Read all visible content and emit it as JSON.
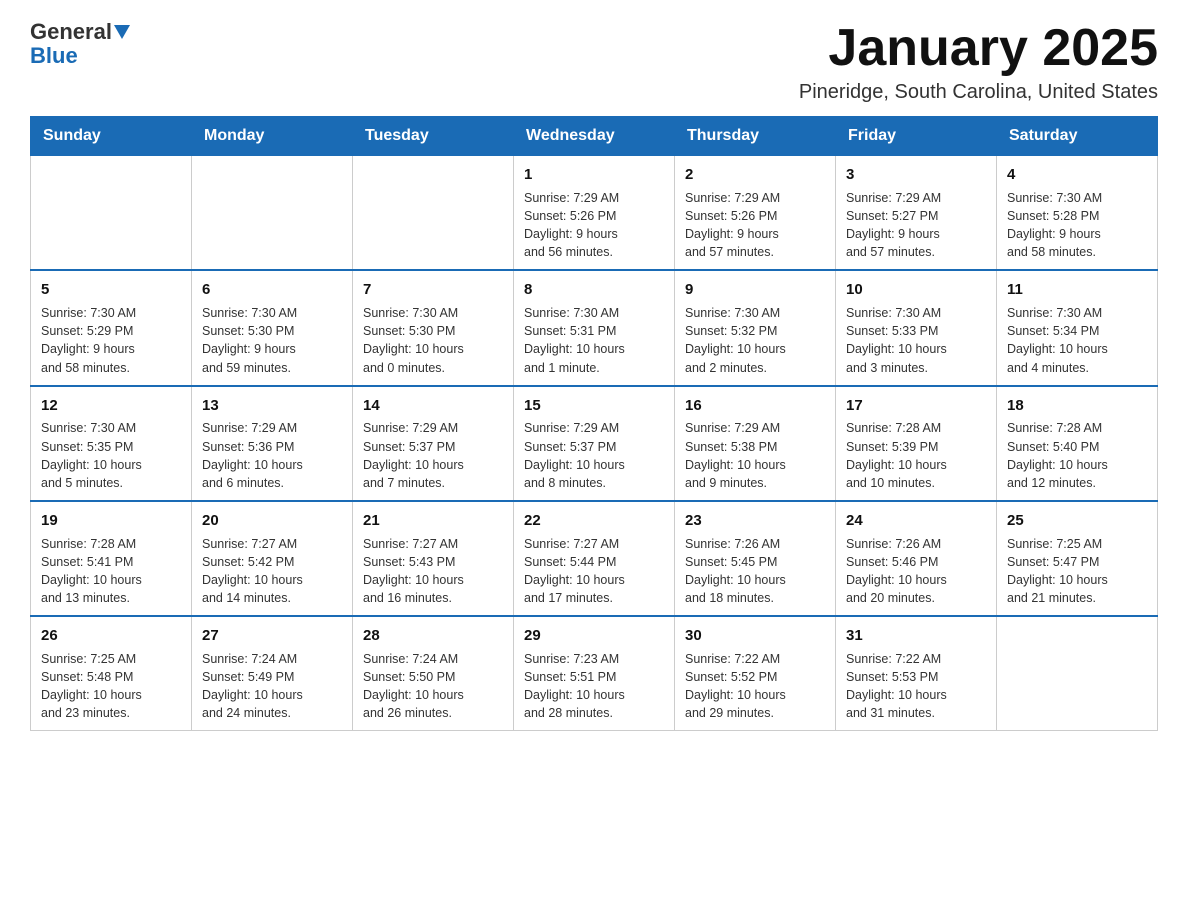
{
  "logo": {
    "text_general": "General",
    "text_blue": "Blue"
  },
  "title": "January 2025",
  "subtitle": "Pineridge, South Carolina, United States",
  "weekdays": [
    "Sunday",
    "Monday",
    "Tuesday",
    "Wednesday",
    "Thursday",
    "Friday",
    "Saturday"
  ],
  "weeks": [
    [
      {
        "day": "",
        "info": ""
      },
      {
        "day": "",
        "info": ""
      },
      {
        "day": "",
        "info": ""
      },
      {
        "day": "1",
        "info": "Sunrise: 7:29 AM\nSunset: 5:26 PM\nDaylight: 9 hours\nand 56 minutes."
      },
      {
        "day": "2",
        "info": "Sunrise: 7:29 AM\nSunset: 5:26 PM\nDaylight: 9 hours\nand 57 minutes."
      },
      {
        "day": "3",
        "info": "Sunrise: 7:29 AM\nSunset: 5:27 PM\nDaylight: 9 hours\nand 57 minutes."
      },
      {
        "day": "4",
        "info": "Sunrise: 7:30 AM\nSunset: 5:28 PM\nDaylight: 9 hours\nand 58 minutes."
      }
    ],
    [
      {
        "day": "5",
        "info": "Sunrise: 7:30 AM\nSunset: 5:29 PM\nDaylight: 9 hours\nand 58 minutes."
      },
      {
        "day": "6",
        "info": "Sunrise: 7:30 AM\nSunset: 5:30 PM\nDaylight: 9 hours\nand 59 minutes."
      },
      {
        "day": "7",
        "info": "Sunrise: 7:30 AM\nSunset: 5:30 PM\nDaylight: 10 hours\nand 0 minutes."
      },
      {
        "day": "8",
        "info": "Sunrise: 7:30 AM\nSunset: 5:31 PM\nDaylight: 10 hours\nand 1 minute."
      },
      {
        "day": "9",
        "info": "Sunrise: 7:30 AM\nSunset: 5:32 PM\nDaylight: 10 hours\nand 2 minutes."
      },
      {
        "day": "10",
        "info": "Sunrise: 7:30 AM\nSunset: 5:33 PM\nDaylight: 10 hours\nand 3 minutes."
      },
      {
        "day": "11",
        "info": "Sunrise: 7:30 AM\nSunset: 5:34 PM\nDaylight: 10 hours\nand 4 minutes."
      }
    ],
    [
      {
        "day": "12",
        "info": "Sunrise: 7:30 AM\nSunset: 5:35 PM\nDaylight: 10 hours\nand 5 minutes."
      },
      {
        "day": "13",
        "info": "Sunrise: 7:29 AM\nSunset: 5:36 PM\nDaylight: 10 hours\nand 6 minutes."
      },
      {
        "day": "14",
        "info": "Sunrise: 7:29 AM\nSunset: 5:37 PM\nDaylight: 10 hours\nand 7 minutes."
      },
      {
        "day": "15",
        "info": "Sunrise: 7:29 AM\nSunset: 5:37 PM\nDaylight: 10 hours\nand 8 minutes."
      },
      {
        "day": "16",
        "info": "Sunrise: 7:29 AM\nSunset: 5:38 PM\nDaylight: 10 hours\nand 9 minutes."
      },
      {
        "day": "17",
        "info": "Sunrise: 7:28 AM\nSunset: 5:39 PM\nDaylight: 10 hours\nand 10 minutes."
      },
      {
        "day": "18",
        "info": "Sunrise: 7:28 AM\nSunset: 5:40 PM\nDaylight: 10 hours\nand 12 minutes."
      }
    ],
    [
      {
        "day": "19",
        "info": "Sunrise: 7:28 AM\nSunset: 5:41 PM\nDaylight: 10 hours\nand 13 minutes."
      },
      {
        "day": "20",
        "info": "Sunrise: 7:27 AM\nSunset: 5:42 PM\nDaylight: 10 hours\nand 14 minutes."
      },
      {
        "day": "21",
        "info": "Sunrise: 7:27 AM\nSunset: 5:43 PM\nDaylight: 10 hours\nand 16 minutes."
      },
      {
        "day": "22",
        "info": "Sunrise: 7:27 AM\nSunset: 5:44 PM\nDaylight: 10 hours\nand 17 minutes."
      },
      {
        "day": "23",
        "info": "Sunrise: 7:26 AM\nSunset: 5:45 PM\nDaylight: 10 hours\nand 18 minutes."
      },
      {
        "day": "24",
        "info": "Sunrise: 7:26 AM\nSunset: 5:46 PM\nDaylight: 10 hours\nand 20 minutes."
      },
      {
        "day": "25",
        "info": "Sunrise: 7:25 AM\nSunset: 5:47 PM\nDaylight: 10 hours\nand 21 minutes."
      }
    ],
    [
      {
        "day": "26",
        "info": "Sunrise: 7:25 AM\nSunset: 5:48 PM\nDaylight: 10 hours\nand 23 minutes."
      },
      {
        "day": "27",
        "info": "Sunrise: 7:24 AM\nSunset: 5:49 PM\nDaylight: 10 hours\nand 24 minutes."
      },
      {
        "day": "28",
        "info": "Sunrise: 7:24 AM\nSunset: 5:50 PM\nDaylight: 10 hours\nand 26 minutes."
      },
      {
        "day": "29",
        "info": "Sunrise: 7:23 AM\nSunset: 5:51 PM\nDaylight: 10 hours\nand 28 minutes."
      },
      {
        "day": "30",
        "info": "Sunrise: 7:22 AM\nSunset: 5:52 PM\nDaylight: 10 hours\nand 29 minutes."
      },
      {
        "day": "31",
        "info": "Sunrise: 7:22 AM\nSunset: 5:53 PM\nDaylight: 10 hours\nand 31 minutes."
      },
      {
        "day": "",
        "info": ""
      }
    ]
  ]
}
